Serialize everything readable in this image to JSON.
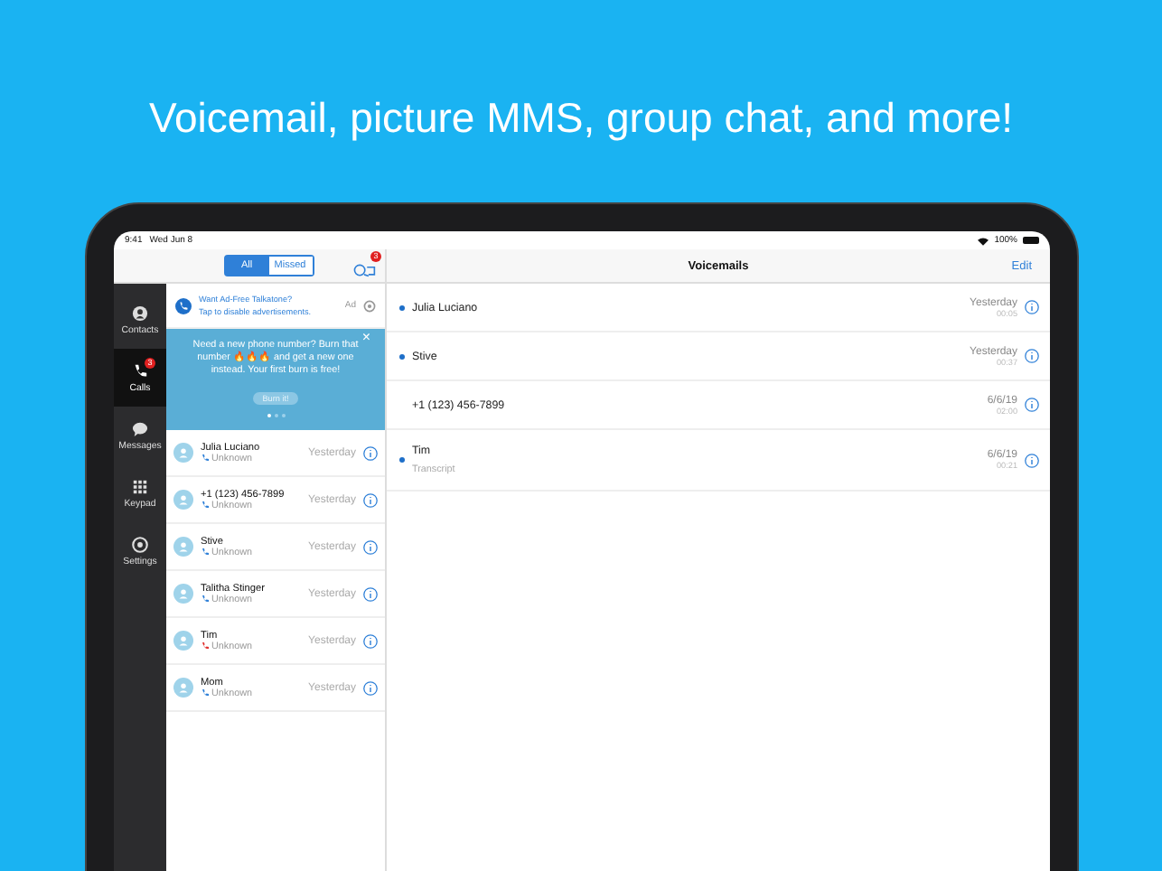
{
  "headline": "Voicemail, picture MMS, group chat, and more!",
  "status_bar": {
    "time": "9:41",
    "date": "Wed Jun 8",
    "battery": "100%"
  },
  "filter_tabs": [
    {
      "label": "All",
      "selected": true
    },
    {
      "label": "Missed",
      "selected": false
    }
  ],
  "search_badge": "3",
  "sidebar": [
    {
      "label": "Contacts",
      "selected": false
    },
    {
      "label": "Calls",
      "selected": true,
      "badge": "3"
    },
    {
      "label": "Messages",
      "selected": false
    },
    {
      "label": "Keypad",
      "selected": false
    },
    {
      "label": "Settings",
      "selected": false
    }
  ],
  "ad": {
    "title": "Want Ad-Free Talkatone?",
    "subtitle": "Tap to disable advertisements.",
    "tag": "Ad"
  },
  "banner": {
    "text": "Need a new phone number? Burn that number 🔥🔥🔥 and get a new one instead. Your first burn is free!",
    "button": "Burn it!",
    "close": "×"
  },
  "calls": [
    {
      "name": "Julia Luciano",
      "detail": "Unknown",
      "time": "Yesterday",
      "missed": false
    },
    {
      "name": "+1 (123) 456-7899",
      "detail": "Unknown",
      "time": "Yesterday",
      "missed": false
    },
    {
      "name": "Stive",
      "detail": "Unknown",
      "time": "Yesterday",
      "missed": false
    },
    {
      "name": "Talitha Stinger",
      "detail": "Unknown",
      "time": "Yesterday",
      "missed": false
    },
    {
      "name": "Tim",
      "detail": "Unknown",
      "time": "Yesterday",
      "missed": true
    },
    {
      "name": "Mom",
      "detail": "Unknown",
      "time": "Yesterday",
      "missed": false
    }
  ],
  "voicemail_header": {
    "title": "Voicemails",
    "edit": "Edit"
  },
  "voicemails": [
    {
      "name": "Julia Luciano",
      "date": "Yesterday",
      "duration": "00:05",
      "unread": true
    },
    {
      "name": "Stive",
      "date": "Yesterday",
      "duration": "00:37",
      "unread": true
    },
    {
      "name": "+1 (123) 456-7899",
      "date": "6/6/19",
      "duration": "02:00",
      "unread": false
    },
    {
      "name": "Tim",
      "transcript": "Transcript",
      "date": "6/6/19",
      "duration": "00:21",
      "unread": true
    }
  ]
}
